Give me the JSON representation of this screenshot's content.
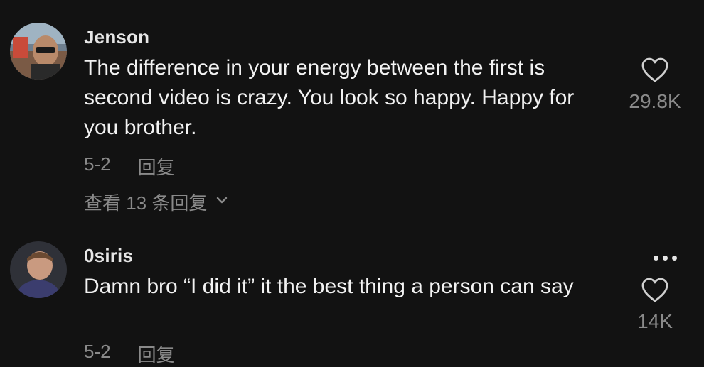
{
  "comments": [
    {
      "username": "Jenson",
      "text": "The difference in your energy between the first is second video is crazy. You look so happy. Happy for you brother.",
      "date": "5-2",
      "reply_label": "回复",
      "view_replies": "查看 13 条回复",
      "likes": "29.8K"
    },
    {
      "username": "0siris",
      "text": "Damn bro “I did it” it the best thing a person can say",
      "date": "5-2",
      "reply_label": "回复",
      "likes": "14K"
    }
  ],
  "icons": {
    "like": "heart-outline-icon",
    "expand": "chevron-down-icon",
    "more": "more-horizontal-icon"
  },
  "colors": {
    "background": "#121212",
    "muted": "#8a8a8a"
  }
}
